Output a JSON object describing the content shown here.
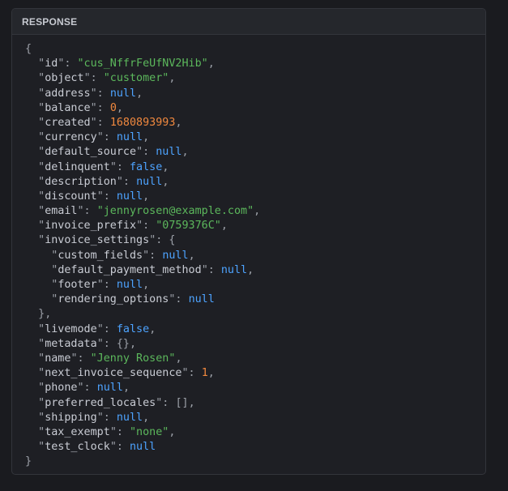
{
  "panel": {
    "title": "RESPONSE"
  },
  "colors": {
    "string": "#5cb85c",
    "number": "#f0883e",
    "keyword": "#4da3ff",
    "key": "#c9ccd4",
    "punctuation": "#9ca0a8"
  },
  "lines": [
    {
      "indent": 0,
      "open": "{"
    },
    {
      "indent": 1,
      "key": "id",
      "value": "\"cus_NffrFeUfNV2Hib\"",
      "type": "string",
      "comma": true
    },
    {
      "indent": 1,
      "key": "object",
      "value": "\"customer\"",
      "type": "string",
      "comma": true
    },
    {
      "indent": 1,
      "key": "address",
      "value": "null",
      "type": "keyword",
      "comma": true
    },
    {
      "indent": 1,
      "key": "balance",
      "value": "0",
      "type": "number",
      "comma": true
    },
    {
      "indent": 1,
      "key": "created",
      "value": "1680893993",
      "type": "number",
      "comma": true
    },
    {
      "indent": 1,
      "key": "currency",
      "value": "null",
      "type": "keyword",
      "comma": true
    },
    {
      "indent": 1,
      "key": "default_source",
      "value": "null",
      "type": "keyword",
      "comma": true
    },
    {
      "indent": 1,
      "key": "delinquent",
      "value": "false",
      "type": "keyword",
      "comma": true
    },
    {
      "indent": 1,
      "key": "description",
      "value": "null",
      "type": "keyword",
      "comma": true
    },
    {
      "indent": 1,
      "key": "discount",
      "value": "null",
      "type": "keyword",
      "comma": true
    },
    {
      "indent": 1,
      "key": "email",
      "value": "\"jennyrosen@example.com\"",
      "type": "string",
      "comma": true
    },
    {
      "indent": 1,
      "key": "invoice_prefix",
      "value": "\"0759376C\"",
      "type": "string",
      "comma": true
    },
    {
      "indent": 1,
      "key": "invoice_settings",
      "open": "{"
    },
    {
      "indent": 2,
      "key": "custom_fields",
      "value": "null",
      "type": "keyword",
      "comma": true
    },
    {
      "indent": 2,
      "key": "default_payment_method",
      "value": "null",
      "type": "keyword",
      "comma": true
    },
    {
      "indent": 2,
      "key": "footer",
      "value": "null",
      "type": "keyword",
      "comma": true
    },
    {
      "indent": 2,
      "key": "rendering_options",
      "value": "null",
      "type": "keyword",
      "comma": false
    },
    {
      "indent": 1,
      "close": "}",
      "comma": true
    },
    {
      "indent": 1,
      "key": "livemode",
      "value": "false",
      "type": "keyword",
      "comma": true
    },
    {
      "indent": 1,
      "key": "metadata",
      "value": "{}",
      "type": "punct",
      "comma": true
    },
    {
      "indent": 1,
      "key": "name",
      "value": "\"Jenny Rosen\"",
      "type": "string",
      "comma": true
    },
    {
      "indent": 1,
      "key": "next_invoice_sequence",
      "value": "1",
      "type": "number",
      "comma": true
    },
    {
      "indent": 1,
      "key": "phone",
      "value": "null",
      "type": "keyword",
      "comma": true
    },
    {
      "indent": 1,
      "key": "preferred_locales",
      "value": "[]",
      "type": "punct",
      "comma": true
    },
    {
      "indent": 1,
      "key": "shipping",
      "value": "null",
      "type": "keyword",
      "comma": true
    },
    {
      "indent": 1,
      "key": "tax_exempt",
      "value": "\"none\"",
      "type": "string",
      "comma": true
    },
    {
      "indent": 1,
      "key": "test_clock",
      "value": "null",
      "type": "keyword",
      "comma": false
    },
    {
      "indent": 0,
      "close": "}",
      "comma": false
    }
  ]
}
